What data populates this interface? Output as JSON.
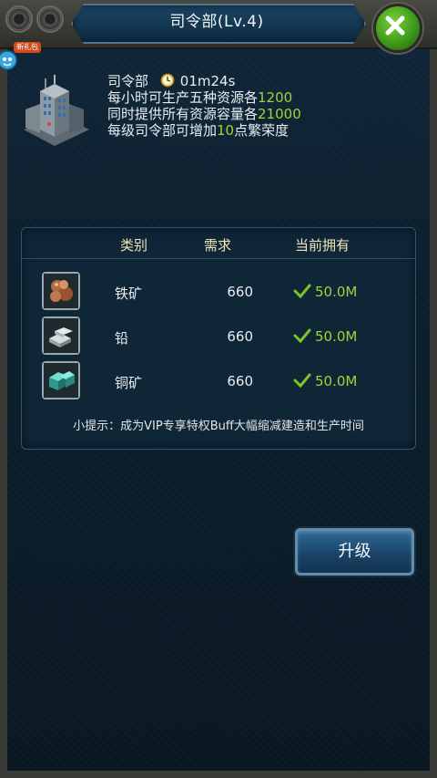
{
  "header": {
    "title": "司令部(Lv.4)"
  },
  "gift": {
    "badge": "新礼包"
  },
  "building": {
    "name": "司令部",
    "timer": "01m24s",
    "line1_prefix": "每小时可生产五种资源各",
    "line1_value": "1200",
    "line2_prefix": "同时提供所有资源容量各",
    "line2_value": "21000",
    "line3_prefix": "每级司令部可增加",
    "line3_value": "10",
    "line3_suffix": "点繁荣度"
  },
  "table": {
    "headers": [
      "类别",
      "需求",
      "当前拥有"
    ],
    "rows": [
      {
        "icon": "iron-ore-icon",
        "name": "铁矿",
        "need": "660",
        "have": "50.0M"
      },
      {
        "icon": "lead-icon",
        "name": "铅",
        "need": "660",
        "have": "50.0M"
      },
      {
        "icon": "copper-ore-icon",
        "name": "铜矿",
        "need": "660",
        "have": "50.0M"
      }
    ],
    "tip": "小提示：成为VIP专享特权Buff大幅缩减建造和生产时间"
  },
  "actions": {
    "upgrade_label": "升级"
  },
  "colors": {
    "highlight": "#9fd43c",
    "header_text": "#f0e6b8",
    "close": "#4fae22"
  }
}
